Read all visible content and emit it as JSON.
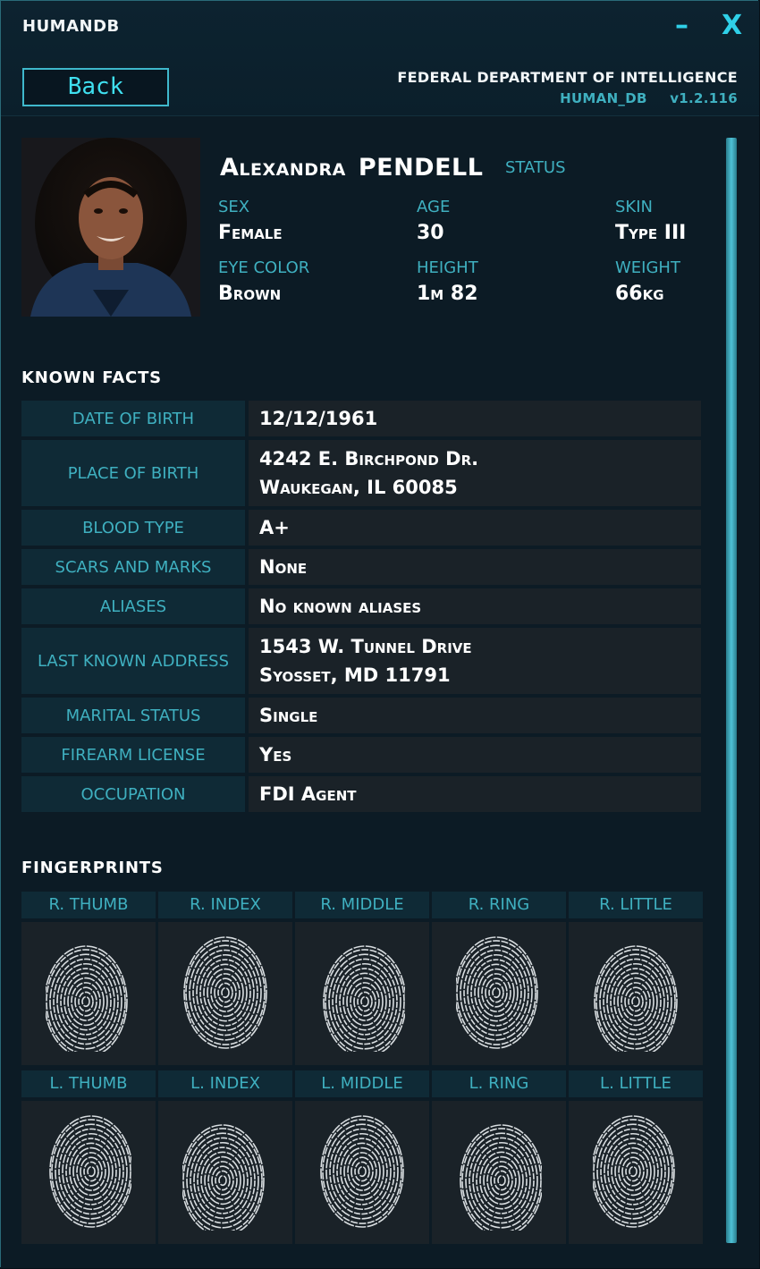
{
  "window": {
    "title": "HUMANDB",
    "minimize_glyph": "–",
    "close_glyph": "X",
    "back_label": "Back",
    "agency": "FEDERAL DEPARTMENT OF INTELLIGENCE",
    "db_name": "HUMAN_DB",
    "version": "v1.2.116"
  },
  "profile": {
    "first_name": "Alexandra",
    "last_name": "PENDELL",
    "status_label": "STATUS",
    "attributes": [
      {
        "label": "SEX",
        "value": "Female"
      },
      {
        "label": "AGE",
        "value": "30"
      },
      {
        "label": "SKIN",
        "value": "Type III"
      },
      {
        "label": "EYE COLOR",
        "value": "Brown"
      },
      {
        "label": "HEIGHT",
        "value": "1m 82"
      },
      {
        "label": "WEIGHT",
        "value": "66kg"
      }
    ]
  },
  "known_facts": {
    "title": "KNOWN  FACTS",
    "rows": [
      {
        "label": "DATE OF BIRTH",
        "lines": [
          "12/12/1961"
        ]
      },
      {
        "label": "PLACE OF BIRTH",
        "lines": [
          "4242 E. Birchpond Dr.",
          "Waukegan, IL 60085"
        ]
      },
      {
        "label": "BLOOD TYPE",
        "lines": [
          "A+"
        ]
      },
      {
        "label": "SCARS AND MARKS",
        "lines": [
          "None"
        ]
      },
      {
        "label": "ALIASES",
        "lines": [
          "No known aliases"
        ]
      },
      {
        "label": "LAST KNOWN ADDRESS",
        "lines": [
          "1543 W. Tunnel Drive",
          "Syosset, MD 11791"
        ]
      },
      {
        "label": "MARITAL STATUS",
        "lines": [
          "Single"
        ]
      },
      {
        "label": "FIREARM LICENSE",
        "lines": [
          "Yes"
        ]
      },
      {
        "label": "OCCUPATION",
        "lines": [
          "FDI Agent"
        ]
      }
    ]
  },
  "fingerprints": {
    "title": "FINGERPRINTS",
    "right": [
      "R. THUMB",
      "R. INDEX",
      "R. MIDDLE",
      "R. RING",
      "R. LITTLE"
    ],
    "left": [
      "L. THUMB",
      "L. INDEX",
      "L. MIDDLE",
      "L. RING",
      "L. LITTLE"
    ]
  },
  "colors": {
    "accent": "#3fb0c0",
    "highlight": "#2fd0e8",
    "label_bg": "#0f2a36",
    "value_bg": "#1a2228"
  }
}
